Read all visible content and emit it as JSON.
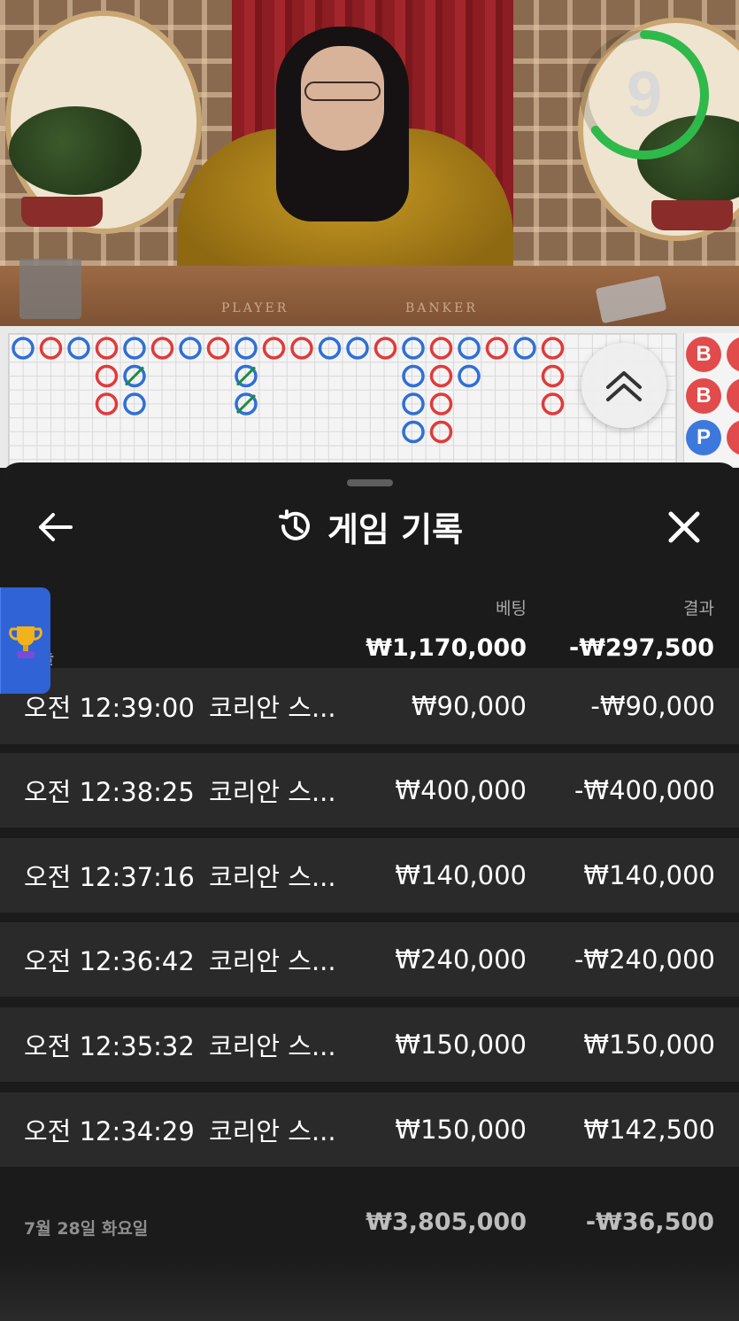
{
  "video": {
    "table_player_label": "PLAYER",
    "table_banker_label": "BANKER",
    "countdown": "9",
    "countdown_progress": 0.65,
    "accent_color": "#2eb94a"
  },
  "roadmap": {
    "bead_labels": [
      "B",
      "B",
      "P"
    ],
    "banker_color": "#e03a3a",
    "player_color": "#2f6fd6",
    "tie_color": "#1e8a3e",
    "expand_icon": "double-chevron-up-icon"
  },
  "history": {
    "title": "게임 기록",
    "history_icon": "history-clock-icon",
    "back_icon": "arrow-left-icon",
    "close_icon": "close-icon",
    "col_bet": "베팅",
    "col_result": "결과",
    "today": {
      "label": "오늘",
      "bet_total": "₩1,170,000",
      "result_total": "-₩297,500"
    },
    "rows": [
      {
        "time": "오전 12:39:00",
        "game": "코리안 스...",
        "bet": "₩90,000",
        "result": "-₩90,000"
      },
      {
        "time": "오전 12:38:25",
        "game": "코리안 스...",
        "bet": "₩400,000",
        "result": "-₩400,000"
      },
      {
        "time": "오전 12:37:16",
        "game": "코리안 스...",
        "bet": "₩140,000",
        "result": "₩140,000"
      },
      {
        "time": "오전 12:36:42",
        "game": "코리안 스...",
        "bet": "₩240,000",
        "result": "-₩240,000"
      },
      {
        "time": "오전 12:35:32",
        "game": "코리안 스...",
        "bet": "₩150,000",
        "result": "₩150,000"
      },
      {
        "time": "오전 12:34:29",
        "game": "코리안 스...",
        "bet": "₩150,000",
        "result": "₩142,500"
      }
    ],
    "prev_day": {
      "label": "7월 28일 화요일",
      "bet_total": "₩3,805,000",
      "result_total": "-₩36,500"
    }
  },
  "side_tab": {
    "icon": "trophy-icon"
  }
}
